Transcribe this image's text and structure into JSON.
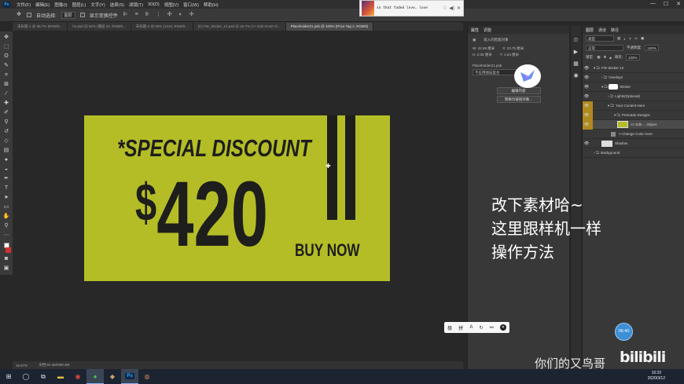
{
  "menubar": {
    "logo": "Ps",
    "items": [
      "文件(F)",
      "编辑(E)",
      "图像(I)",
      "图层(L)",
      "文字(Y)",
      "选择(S)",
      "滤镜(T)",
      "3D(D)",
      "视图(V)",
      "窗口(W)",
      "帮助(H)"
    ],
    "window_controls": [
      "—",
      "☐",
      "✕"
    ]
  },
  "optionsbar": {
    "auto_select_label": "自动选择:",
    "auto_select_value": "图层",
    "show_transform_label": "显示变换控件"
  },
  "music": {
    "song": "so that faded love, love",
    "icons": [
      "heart-icon",
      "volume-icon",
      "close-icon"
    ]
  },
  "doctabs": [
    {
      "label": "未标题-1 @ 66.7% (RGB/8...",
      "active": false
    },
    {
      "label": "ho.psd @ 50% (图层 22, RGB/8...",
      "active": false
    },
    {
      "label": "未标题-2 @ 50% (1210, RGB/8...",
      "active": false
    },
    {
      "label": "[C] FW_Sticker_12.psd @ 16.7% (<< Edit Smart O...",
      "active": false
    },
    {
      "label": "Placeholder21.psb @ 100% (Price Tag 2, RGB/8)",
      "active": true
    }
  ],
  "artboard": {
    "bg_color": "#b4bd26",
    "heading": "*SPECIAL DISCOUNT",
    "price_symbol": "$",
    "price_value": "420",
    "cta": "BUY NOW"
  },
  "statusbar": {
    "zoom": "16.67%",
    "doc": "文档:91.4M/290.3M"
  },
  "properties": {
    "tabs": [
      "属性",
      "调整"
    ],
    "type": "嵌入的智能对象",
    "w_label": "W:",
    "w_value": "42.69 厘米",
    "h_label": "H:",
    "h_value": "2.06 厘米",
    "x_label": "X:",
    "x_value": "23.75 厘米",
    "y_label": "Y:",
    "y_value": "1.64 厘米",
    "file": "Placeholder21.psb",
    "comps": "不应用图层复合",
    "edit_btn": "编辑内容",
    "convert_btn": "转换为链接对象..."
  },
  "layers": {
    "tabs": [
      "图层",
      "通道",
      "路径"
    ],
    "kind": "类型",
    "blend": "正常",
    "opacity_label": "不透明度:",
    "opacity_value": "100%",
    "lock_label": "锁定:",
    "fill_label": "填充:",
    "fill_value": "100%",
    "rows": [
      {
        "name": "FW Sticker 12",
        "indent": 0
      },
      {
        "name": "Overlays",
        "indent": 1
      },
      {
        "name": "Sticker",
        "indent": 1
      },
      {
        "name": "Lights(Optional)",
        "indent": 2
      },
      {
        "name": "Your Content Here",
        "indent": 2
      },
      {
        "name": "Premade Designs",
        "indent": 3
      },
      {
        "name": "<< Edit ... Object",
        "indent": 4
      },
      {
        "name": "<-Change Color Here",
        "indent": 3
      },
      {
        "name": "Shadow",
        "indent": 1
      },
      {
        "name": "Background",
        "indent": 0
      }
    ]
  },
  "subtitles": [
    "改下素材哈~",
    "这里跟样机一样",
    "操作方法"
  ],
  "bilibili": {
    "name": "你们的又鸟哥",
    "logo": "bilibili"
  },
  "timer": "06:40",
  "ime": [
    "极",
    "拼",
    "A",
    "↻",
    "⚯",
    "✕"
  ],
  "clock": {
    "time": "16:20",
    "date": "2020/3/12"
  }
}
